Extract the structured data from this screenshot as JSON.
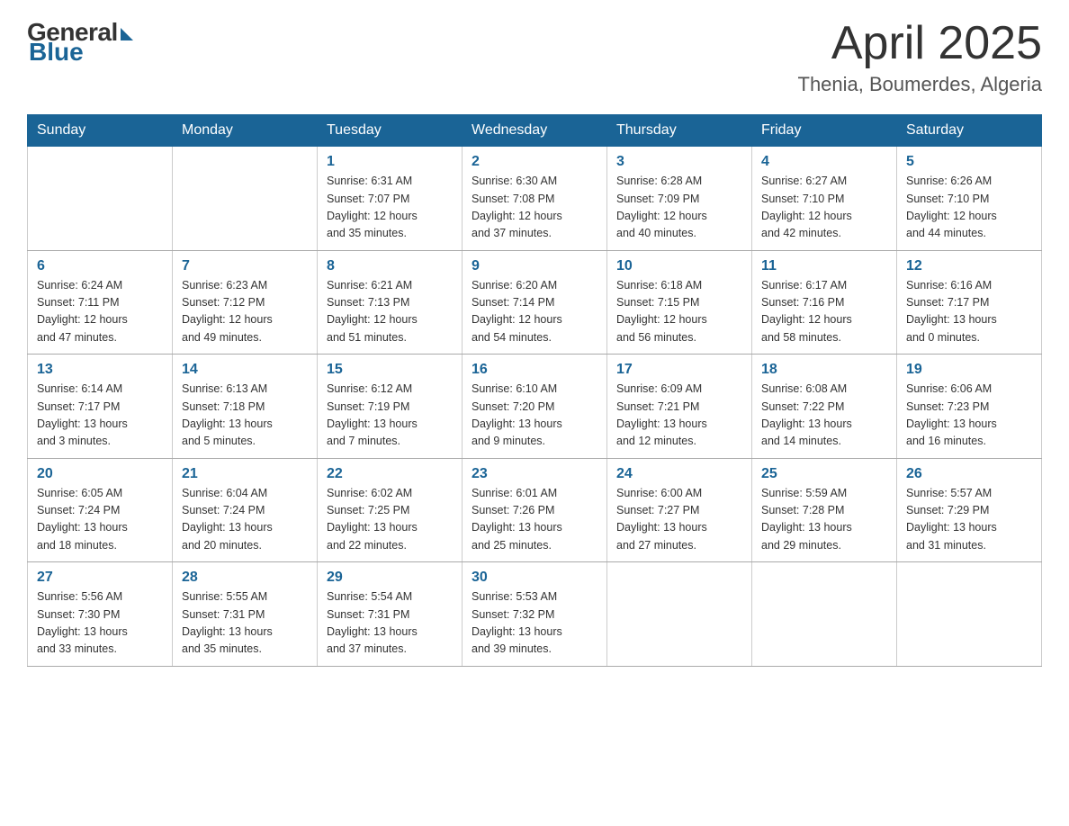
{
  "logo": {
    "general": "General",
    "blue": "Blue"
  },
  "header": {
    "month": "April 2025",
    "location": "Thenia, Boumerdes, Algeria"
  },
  "weekdays": [
    "Sunday",
    "Monday",
    "Tuesday",
    "Wednesday",
    "Thursday",
    "Friday",
    "Saturday"
  ],
  "weeks": [
    [
      {
        "day": "",
        "info": ""
      },
      {
        "day": "",
        "info": ""
      },
      {
        "day": "1",
        "info": "Sunrise: 6:31 AM\nSunset: 7:07 PM\nDaylight: 12 hours\nand 35 minutes."
      },
      {
        "day": "2",
        "info": "Sunrise: 6:30 AM\nSunset: 7:08 PM\nDaylight: 12 hours\nand 37 minutes."
      },
      {
        "day": "3",
        "info": "Sunrise: 6:28 AM\nSunset: 7:09 PM\nDaylight: 12 hours\nand 40 minutes."
      },
      {
        "day": "4",
        "info": "Sunrise: 6:27 AM\nSunset: 7:10 PM\nDaylight: 12 hours\nand 42 minutes."
      },
      {
        "day": "5",
        "info": "Sunrise: 6:26 AM\nSunset: 7:10 PM\nDaylight: 12 hours\nand 44 minutes."
      }
    ],
    [
      {
        "day": "6",
        "info": "Sunrise: 6:24 AM\nSunset: 7:11 PM\nDaylight: 12 hours\nand 47 minutes."
      },
      {
        "day": "7",
        "info": "Sunrise: 6:23 AM\nSunset: 7:12 PM\nDaylight: 12 hours\nand 49 minutes."
      },
      {
        "day": "8",
        "info": "Sunrise: 6:21 AM\nSunset: 7:13 PM\nDaylight: 12 hours\nand 51 minutes."
      },
      {
        "day": "9",
        "info": "Sunrise: 6:20 AM\nSunset: 7:14 PM\nDaylight: 12 hours\nand 54 minutes."
      },
      {
        "day": "10",
        "info": "Sunrise: 6:18 AM\nSunset: 7:15 PM\nDaylight: 12 hours\nand 56 minutes."
      },
      {
        "day": "11",
        "info": "Sunrise: 6:17 AM\nSunset: 7:16 PM\nDaylight: 12 hours\nand 58 minutes."
      },
      {
        "day": "12",
        "info": "Sunrise: 6:16 AM\nSunset: 7:17 PM\nDaylight: 13 hours\nand 0 minutes."
      }
    ],
    [
      {
        "day": "13",
        "info": "Sunrise: 6:14 AM\nSunset: 7:17 PM\nDaylight: 13 hours\nand 3 minutes."
      },
      {
        "day": "14",
        "info": "Sunrise: 6:13 AM\nSunset: 7:18 PM\nDaylight: 13 hours\nand 5 minutes."
      },
      {
        "day": "15",
        "info": "Sunrise: 6:12 AM\nSunset: 7:19 PM\nDaylight: 13 hours\nand 7 minutes."
      },
      {
        "day": "16",
        "info": "Sunrise: 6:10 AM\nSunset: 7:20 PM\nDaylight: 13 hours\nand 9 minutes."
      },
      {
        "day": "17",
        "info": "Sunrise: 6:09 AM\nSunset: 7:21 PM\nDaylight: 13 hours\nand 12 minutes."
      },
      {
        "day": "18",
        "info": "Sunrise: 6:08 AM\nSunset: 7:22 PM\nDaylight: 13 hours\nand 14 minutes."
      },
      {
        "day": "19",
        "info": "Sunrise: 6:06 AM\nSunset: 7:23 PM\nDaylight: 13 hours\nand 16 minutes."
      }
    ],
    [
      {
        "day": "20",
        "info": "Sunrise: 6:05 AM\nSunset: 7:24 PM\nDaylight: 13 hours\nand 18 minutes."
      },
      {
        "day": "21",
        "info": "Sunrise: 6:04 AM\nSunset: 7:24 PM\nDaylight: 13 hours\nand 20 minutes."
      },
      {
        "day": "22",
        "info": "Sunrise: 6:02 AM\nSunset: 7:25 PM\nDaylight: 13 hours\nand 22 minutes."
      },
      {
        "day": "23",
        "info": "Sunrise: 6:01 AM\nSunset: 7:26 PM\nDaylight: 13 hours\nand 25 minutes."
      },
      {
        "day": "24",
        "info": "Sunrise: 6:00 AM\nSunset: 7:27 PM\nDaylight: 13 hours\nand 27 minutes."
      },
      {
        "day": "25",
        "info": "Sunrise: 5:59 AM\nSunset: 7:28 PM\nDaylight: 13 hours\nand 29 minutes."
      },
      {
        "day": "26",
        "info": "Sunrise: 5:57 AM\nSunset: 7:29 PM\nDaylight: 13 hours\nand 31 minutes."
      }
    ],
    [
      {
        "day": "27",
        "info": "Sunrise: 5:56 AM\nSunset: 7:30 PM\nDaylight: 13 hours\nand 33 minutes."
      },
      {
        "day": "28",
        "info": "Sunrise: 5:55 AM\nSunset: 7:31 PM\nDaylight: 13 hours\nand 35 minutes."
      },
      {
        "day": "29",
        "info": "Sunrise: 5:54 AM\nSunset: 7:31 PM\nDaylight: 13 hours\nand 37 minutes."
      },
      {
        "day": "30",
        "info": "Sunrise: 5:53 AM\nSunset: 7:32 PM\nDaylight: 13 hours\nand 39 minutes."
      },
      {
        "day": "",
        "info": ""
      },
      {
        "day": "",
        "info": ""
      },
      {
        "day": "",
        "info": ""
      }
    ]
  ]
}
